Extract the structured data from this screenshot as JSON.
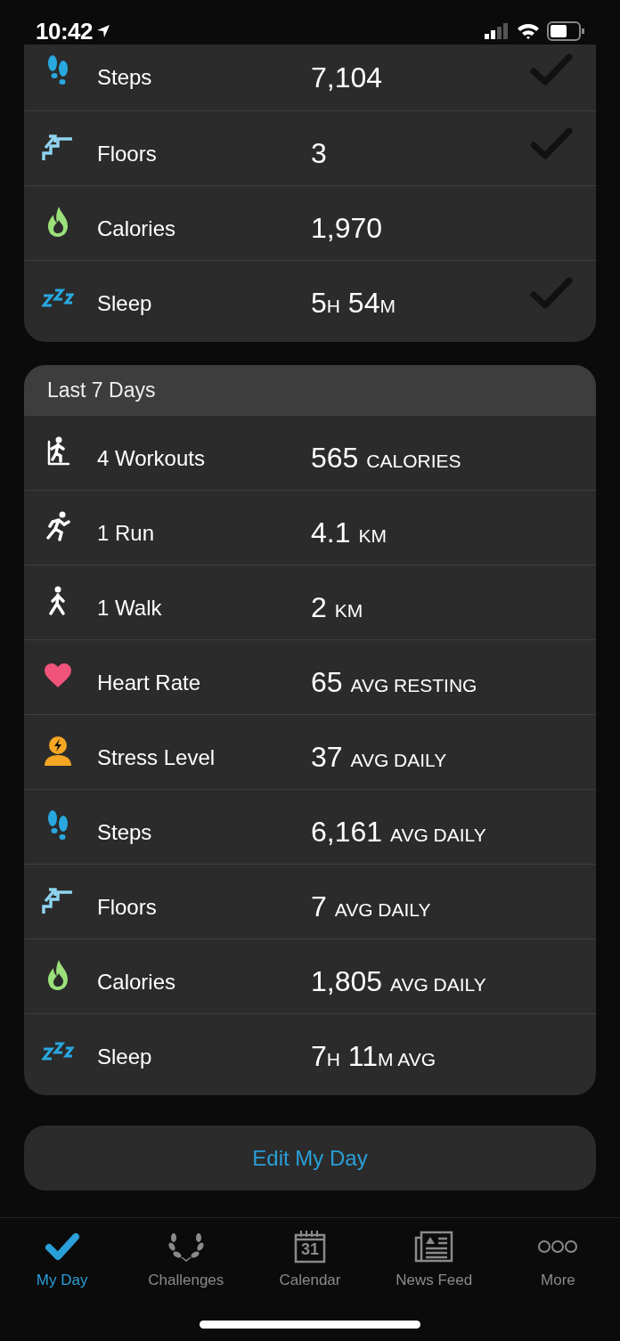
{
  "status_bar": {
    "time": "10:42"
  },
  "today": {
    "rows": [
      {
        "kind": "steps",
        "label": "Steps",
        "goal_met": true,
        "value": [
          {
            "number": "7,104"
          }
        ]
      },
      {
        "kind": "floors",
        "label": "Floors",
        "goal_met": true,
        "value": [
          {
            "number": "3"
          }
        ]
      },
      {
        "kind": "calories",
        "label": "Calories",
        "goal_met": false,
        "value": [
          {
            "number": "1,970"
          }
        ]
      },
      {
        "kind": "sleep",
        "label": "Sleep",
        "goal_met": true,
        "value": [
          {
            "number": "5",
            "unit": "H"
          },
          {
            "number": "54",
            "unit": "M"
          }
        ]
      }
    ]
  },
  "last_7_days": {
    "title": "Last 7 Days",
    "rows": [
      {
        "kind": "workout",
        "label": "4 Workouts",
        "value": [
          {
            "number": "565",
            "unit": "CALORIES"
          }
        ]
      },
      {
        "kind": "run",
        "label": "1 Run",
        "value": [
          {
            "number": "4.1",
            "unit": "KM"
          }
        ]
      },
      {
        "kind": "walk",
        "label": "1 Walk",
        "value": [
          {
            "number": "2",
            "unit": "KM"
          }
        ]
      },
      {
        "kind": "heart",
        "label": "Heart Rate",
        "value": [
          {
            "number": "65",
            "unit": "AVG RESTING"
          }
        ]
      },
      {
        "kind": "stress",
        "label": "Stress Level",
        "value": [
          {
            "number": "37",
            "unit": "AVG DAILY"
          }
        ]
      },
      {
        "kind": "steps",
        "label": "Steps",
        "value": [
          {
            "number": "6,161",
            "unit": "AVG DAILY"
          }
        ]
      },
      {
        "kind": "floors",
        "label": "Floors",
        "value": [
          {
            "number": "7",
            "unit": "AVG DAILY"
          }
        ]
      },
      {
        "kind": "calories",
        "label": "Calories",
        "value": [
          {
            "number": "1,805",
            "unit": "AVG DAILY"
          }
        ]
      },
      {
        "kind": "sleep",
        "label": "Sleep",
        "value": [
          {
            "number": "7",
            "unit": "H"
          },
          {
            "number": "11",
            "unit": "M AVG"
          }
        ]
      }
    ]
  },
  "edit_button": {
    "label": "Edit My Day"
  },
  "tab_bar": [
    {
      "kind": "check",
      "label": "My Day",
      "selected": true
    },
    {
      "kind": "laurel",
      "label": "Challenges",
      "selected": false
    },
    {
      "kind": "calendar",
      "label": "Calendar",
      "selected": false,
      "icon_text": "31"
    },
    {
      "kind": "news",
      "label": "News Feed",
      "selected": false
    },
    {
      "kind": "more",
      "label": "More",
      "selected": false
    }
  ]
}
